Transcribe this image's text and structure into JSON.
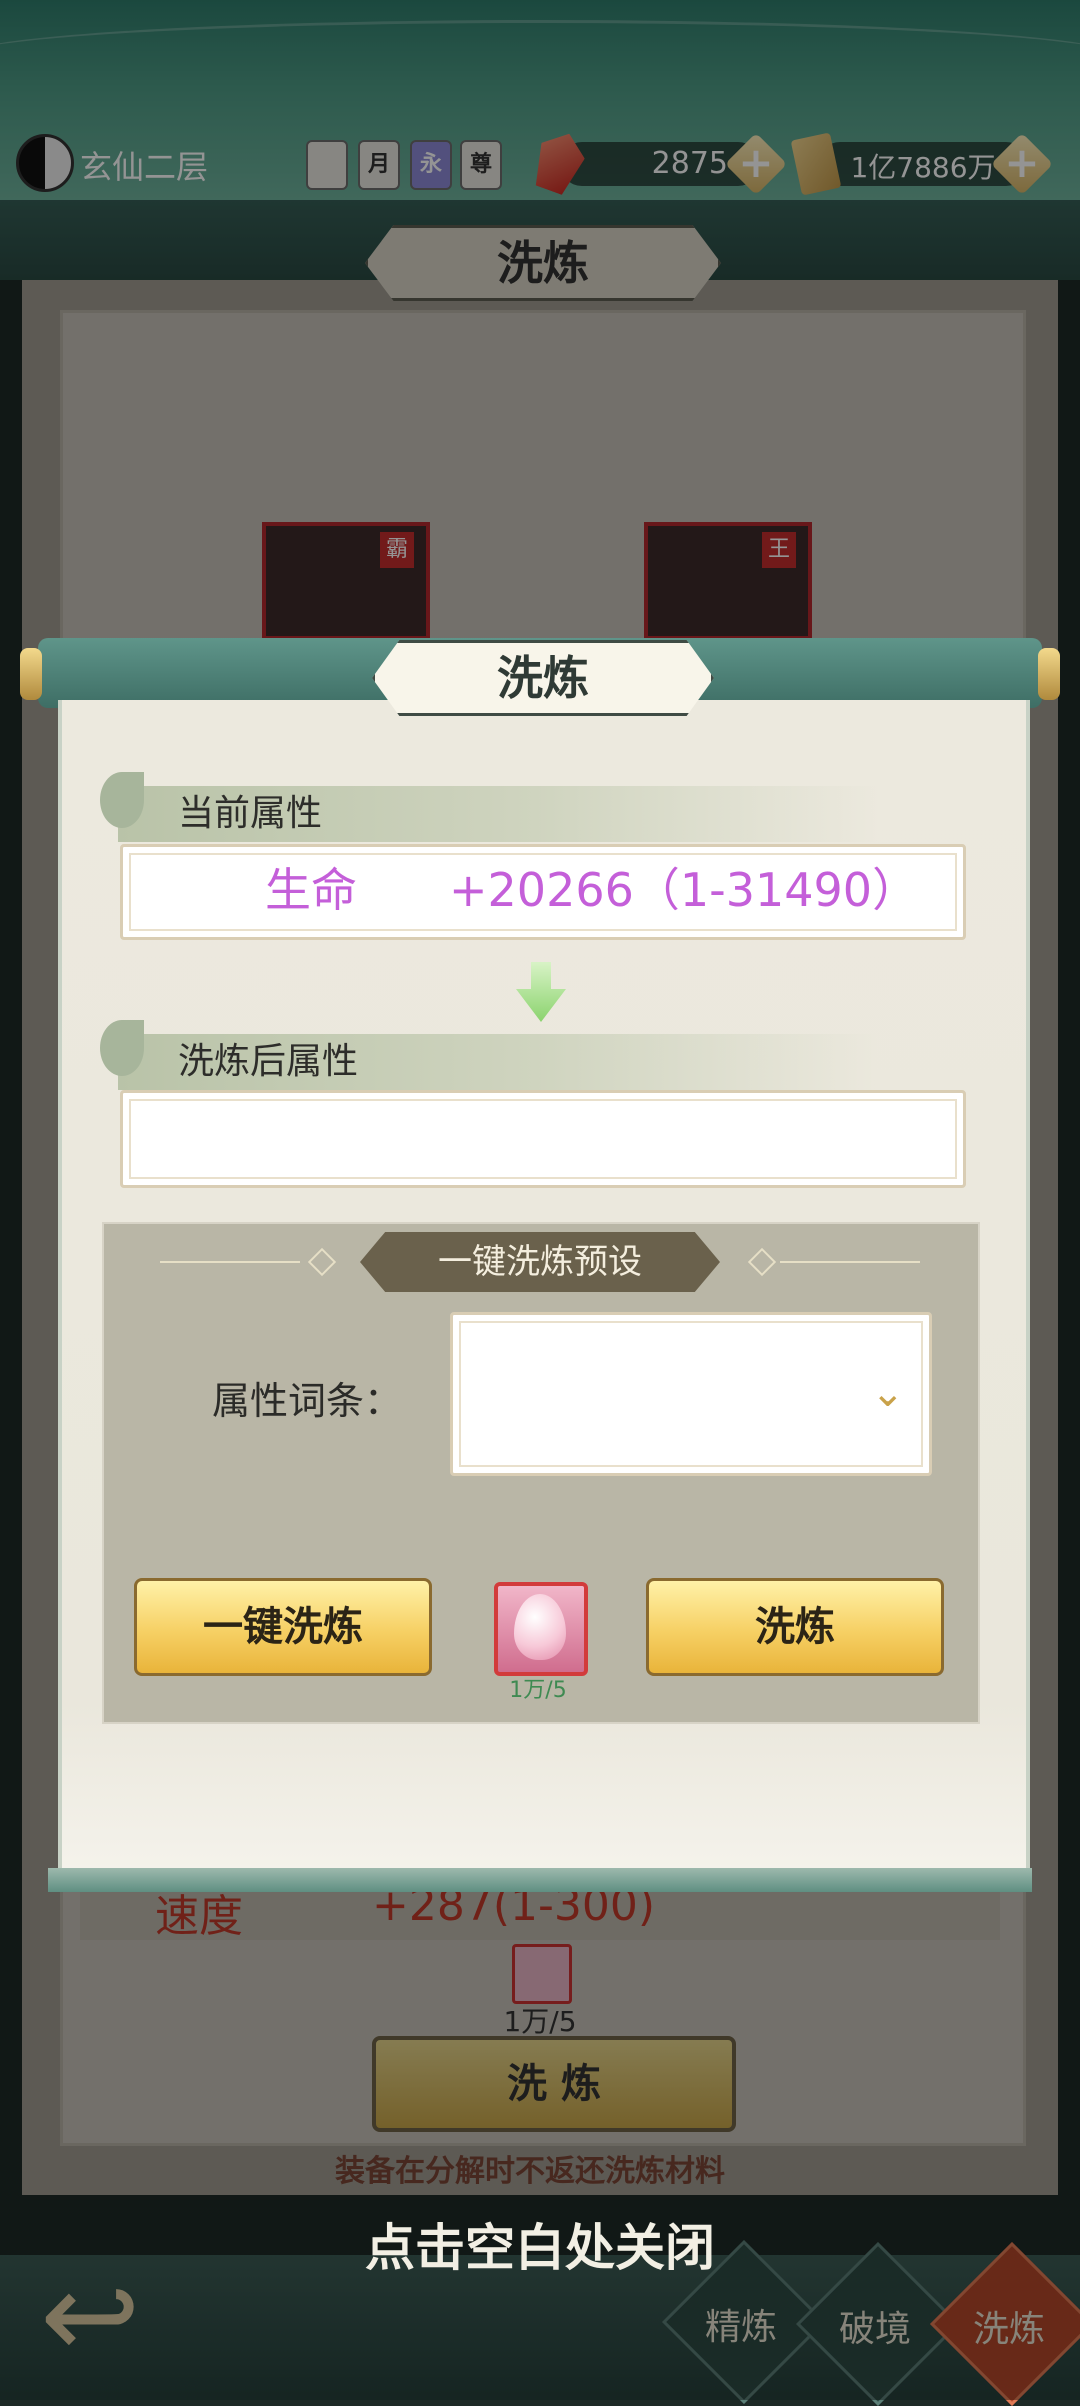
{
  "header": {
    "realm": "玄仙二层",
    "badges": [
      "",
      "月",
      "永",
      "尊"
    ],
    "gems": "2875",
    "scrolls": "1亿7886万"
  },
  "background": {
    "title": "洗炼",
    "card1_tag": "霸",
    "card2_tag": "王",
    "stat_label": "速度",
    "stat_value": "+287(1-300)",
    "cost": "1万/5",
    "button": "洗 炼",
    "notice": "装备在分解时不返还洗炼材料",
    "close_hint": "点击空白处关闭"
  },
  "bottom_nav": [
    {
      "label": "精炼"
    },
    {
      "label": "破境"
    },
    {
      "label": "洗炼"
    }
  ],
  "dialog": {
    "title": "洗炼",
    "current_section": "当前属性",
    "current_stat": "生命",
    "current_value": "+20266（1-31490）",
    "after_section": "洗炼后属性",
    "after_value": "",
    "preset_title": "一键洗炼预设",
    "attr_label": "属性词条：",
    "attr_select_value": "",
    "one_click_button": "一键洗炼",
    "refine_button": "洗炼",
    "cost": "1万/5"
  },
  "colors": {
    "stat_purple": "#c45fd9",
    "bg_stat_red": "#c23a2a",
    "cost_green": "#3f8a52"
  }
}
